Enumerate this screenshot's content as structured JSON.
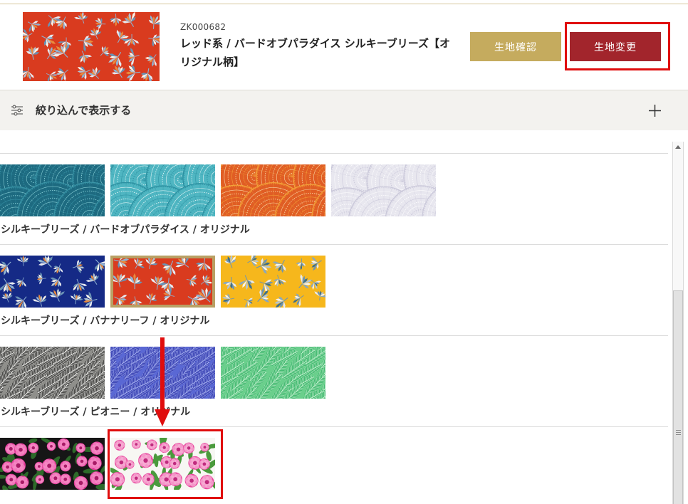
{
  "header": {
    "product_code": "ZK000682",
    "product_title": "レッド系 / バードオブパラダイス シルキーブリーズ【オリジナル柄】",
    "product_image": {
      "pattern": "bird-of-paradise",
      "ground": "#d93b1f",
      "motif": [
        "#e6e9ef",
        "#8fb3d2",
        "#e98b3d",
        "#b3c4d2",
        "#f7f3ea",
        "#6a93b5"
      ]
    },
    "check_button_label": "生地確認",
    "change_button_label": "生地変更"
  },
  "filter": {
    "label": "絞り込んで表示する",
    "icon": "sliders-icon",
    "toggle_icon": "plus-icon"
  },
  "groups": [
    {
      "swatches": [
        {
          "pattern": "feather-fan",
          "ground": "#1d6a80",
          "line": "#8fd6dc",
          "accent": "#3b96a8"
        },
        {
          "pattern": "feather-fan",
          "ground": "#4fb6c2",
          "line": "#eefafa",
          "accent": "#2b8fa0"
        },
        {
          "pattern": "feather-fan",
          "ground": "#e05d24",
          "line": "#fbe0b0",
          "accent": "#f3a43a"
        },
        {
          "pattern": "feather-fan",
          "ground": "#e8e7ef",
          "line": "#ffffff",
          "accent": "#c9c7d9"
        }
      ]
    },
    {
      "title": "シルキーブリーズ / バードオブパラダイス / オリジナル",
      "swatches": [
        {
          "pattern": "bird-of-paradise",
          "ground": "#152a86",
          "motif": [
            "#e6e9ef",
            "#8fb3d2",
            "#e98b3d",
            "#b3c4d2",
            "#f7f3ea",
            "#6a93b5"
          ]
        },
        {
          "pattern": "bird-of-paradise",
          "ground": "#d93b1f",
          "motif": [
            "#e6e9ef",
            "#8fb3d2",
            "#e98b3d",
            "#b3c4d2",
            "#f7f3ea",
            "#6a93b5"
          ],
          "selected": true
        },
        {
          "pattern": "bird-of-paradise",
          "ground": "#f6b71c",
          "motif": [
            "#e6e9ef",
            "#6f94b0",
            "#3f6f8a",
            "#b3c4d2",
            "#f7f3ea",
            "#8aa8bd"
          ]
        }
      ]
    },
    {
      "title": "シルキーブリーズ / バナナリーフ / オリジナル",
      "swatches": [
        {
          "pattern": "banana-leaf",
          "ground": "#8f8f8b",
          "leaf": "#4a4a48",
          "vein": "#efefec"
        },
        {
          "pattern": "banana-leaf",
          "ground": "#5a68d4",
          "leaf": "#3e47b6",
          "vein": "#a7b1f0"
        },
        {
          "pattern": "banana-leaf",
          "ground": "#6acf8c",
          "leaf": "#47bb73",
          "vein": "#c4f0cf"
        }
      ]
    },
    {
      "title": "シルキーブリーズ / ピオニー / オリジナル",
      "swatches": [
        {
          "pattern": "peony",
          "ground": "#161616",
          "leaf": "#2d6a2a",
          "flower": "#e2399a",
          "petal": "#f58cc6",
          "center": "#a81a66"
        },
        {
          "pattern": "peony",
          "ground": "#f7f7f3",
          "leaf": "#4a9a3c",
          "flower": "#e8489f",
          "petal": "#f8b0d5",
          "center": "#c02a7e"
        }
      ]
    }
  ],
  "colors": {
    "button_gold": "#c5ab5e",
    "button_red": "#a2252c",
    "selected_frame": "#b9a064",
    "annotation_red": "#e00d0d"
  }
}
